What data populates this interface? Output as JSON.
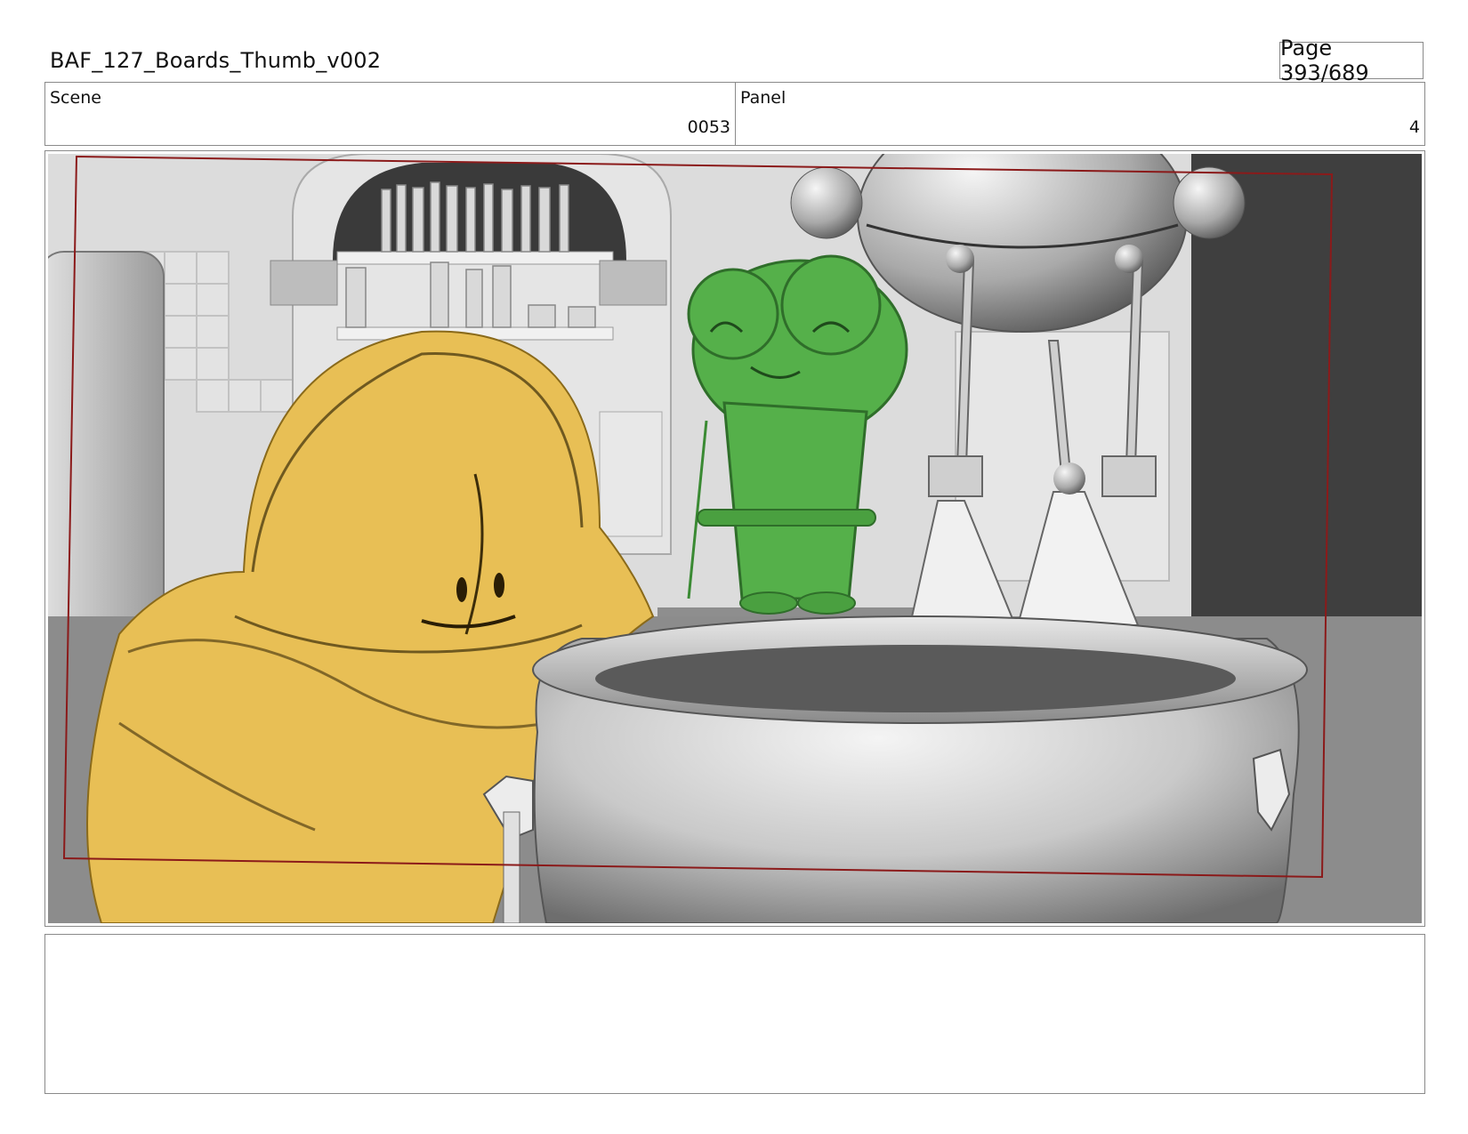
{
  "header": {
    "title": "BAF_127_Boards_Thumb_v002",
    "page": "Page 393/689"
  },
  "info": {
    "scene_label": "Scene",
    "scene_value": "0053",
    "panel_label": "Panel",
    "panel_value": "4"
  },
  "frame": {
    "content": "storyboard-panel-drawing",
    "colors": {
      "safe_frame": "#8b1a1a",
      "character_yellow": "#e8bf55",
      "character_green": "#55b04a",
      "set_gray": "#cfcfcf"
    }
  },
  "notes": {
    "text": ""
  }
}
